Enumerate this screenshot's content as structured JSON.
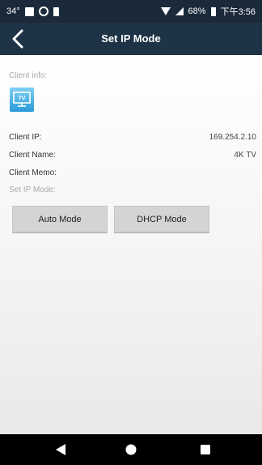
{
  "status_bar": {
    "temperature": "34°",
    "battery_percent": "68%",
    "time": "下午3:56"
  },
  "app_bar": {
    "title": "Set IP Mode",
    "back_icon": "chevron-left-icon"
  },
  "client_info": {
    "section_label": "Client info:",
    "device_icon": "tv-icon",
    "device_icon_text": "TV",
    "client_ip_label": "Client IP:",
    "client_ip_value": "169.254.2.10",
    "client_name_label": "Client Name:",
    "client_name_value": "4K TV",
    "client_memo_label": "Client Memo:",
    "client_memo_value": "",
    "set_ip_mode_label": "Set IP Mode:"
  },
  "buttons": {
    "auto_mode": "Auto Mode",
    "dhcp_mode": "DHCP Mode"
  },
  "nav_bar": {
    "back_icon": "back-triangle-icon",
    "home_icon": "home-circle-icon",
    "recents_icon": "recents-square-icon"
  },
  "colors": {
    "app_bar": "#1f3347",
    "status_bar": "#1a2a3a",
    "content_bg": "#f3f3f3",
    "button_bg": "#d4d4d4",
    "nav_bar": "#000000",
    "tv_icon": "#3aa6e3"
  }
}
